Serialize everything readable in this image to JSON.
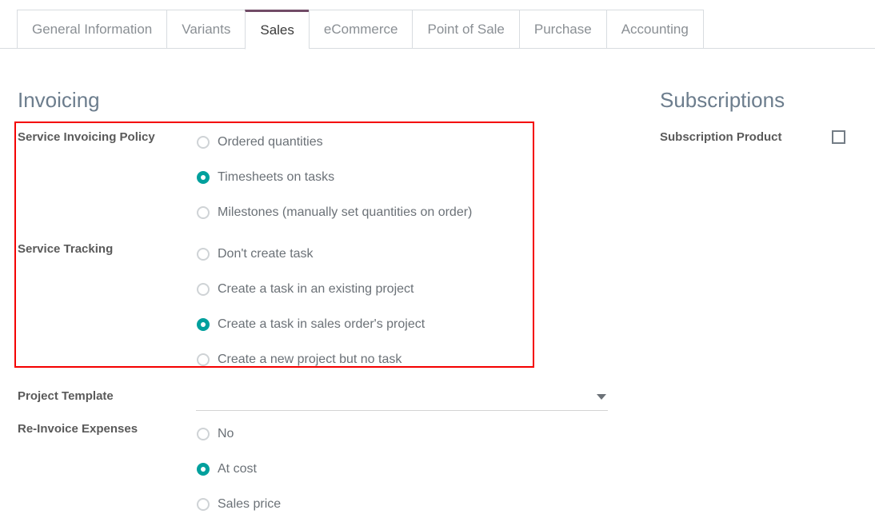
{
  "tabs": [
    {
      "label": "General Information",
      "active": false
    },
    {
      "label": "Variants",
      "active": false
    },
    {
      "label": "Sales",
      "active": true
    },
    {
      "label": "eCommerce",
      "active": false
    },
    {
      "label": "Point of Sale",
      "active": false
    },
    {
      "label": "Purchase",
      "active": false
    },
    {
      "label": "Accounting",
      "active": false
    }
  ],
  "invoicing": {
    "section_title": "Invoicing",
    "service_invoicing_policy": {
      "label": "Service Invoicing Policy",
      "options": [
        {
          "label": "Ordered quantities",
          "selected": false
        },
        {
          "label": "Timesheets on tasks",
          "selected": true
        },
        {
          "label": "Milestones (manually set quantities on order)",
          "selected": false
        }
      ]
    },
    "service_tracking": {
      "label": "Service Tracking",
      "options": [
        {
          "label": "Don't create task",
          "selected": false
        },
        {
          "label": "Create a task in an existing project",
          "selected": false
        },
        {
          "label": "Create a task in sales order's project",
          "selected": true
        },
        {
          "label": "Create a new project but no task",
          "selected": false
        }
      ]
    },
    "project_template": {
      "label": "Project Template",
      "value": "",
      "placeholder": ""
    },
    "re_invoice_expenses": {
      "label": "Re-Invoice Expenses",
      "options": [
        {
          "label": "No",
          "selected": false
        },
        {
          "label": "At cost",
          "selected": true
        },
        {
          "label": "Sales price",
          "selected": false
        }
      ]
    }
  },
  "subscriptions": {
    "section_title": "Subscriptions",
    "subscription_product": {
      "label": "Subscription Product",
      "checked": false
    }
  },
  "colors": {
    "accent_purple": "#714B67",
    "radio_selected": "#00a09d",
    "highlight_border": "#f40000",
    "heading": "#6c7d8d",
    "tab_border": "#d8dce0"
  }
}
